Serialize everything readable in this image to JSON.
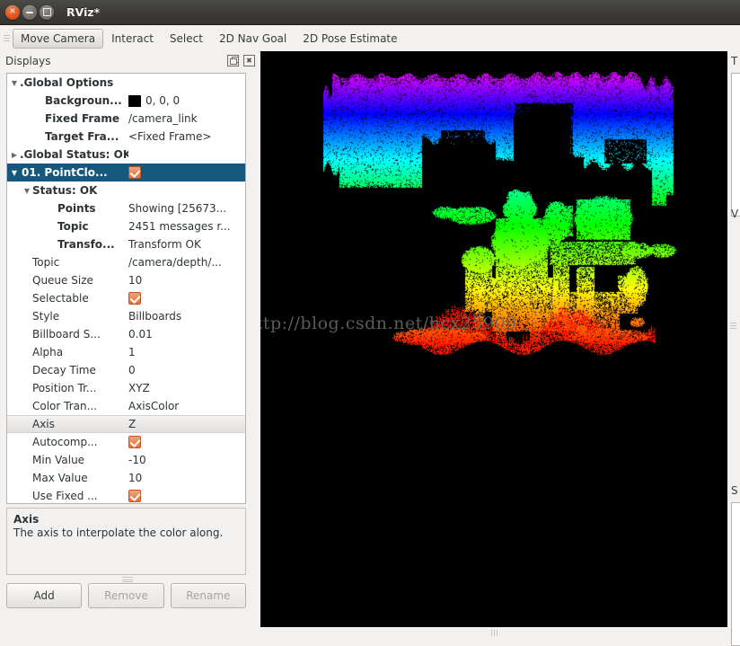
{
  "window": {
    "title": "RViz*",
    "buttons": {
      "close": "close-button",
      "minimize": "minimize-button",
      "maximize": "maximize-button"
    }
  },
  "toolbar": {
    "items": [
      {
        "label": "Move Camera",
        "active": true
      },
      {
        "label": "Interact",
        "active": false
      },
      {
        "label": "Select",
        "active": false
      },
      {
        "label": "2D Nav Goal",
        "active": false
      },
      {
        "label": "2D Pose Estimate",
        "active": false
      }
    ]
  },
  "displays_panel": {
    "title": "Displays",
    "float_icon": "float-icon",
    "close_icon": "close-icon",
    "tree": [
      {
        "indent": 1,
        "arrow": "down",
        "key": ".Global Options",
        "bold": true,
        "value": ""
      },
      {
        "indent": 3,
        "arrow": "",
        "key": "Backgroun...",
        "bold": true,
        "value": "0, 0, 0",
        "swatch": "#000000"
      },
      {
        "indent": 3,
        "arrow": "",
        "key": "Fixed Frame",
        "bold": true,
        "value": "/camera_link"
      },
      {
        "indent": 3,
        "arrow": "",
        "key": "Target Fra...",
        "bold": true,
        "value": "<Fixed Frame>"
      },
      {
        "indent": 1,
        "arrow": "right",
        "key": ".Global Status: OK",
        "bold": true,
        "value": ""
      },
      {
        "indent": 1,
        "arrow": "down",
        "key": "01. PointClo...",
        "bold": true,
        "value": "",
        "checkbox": true,
        "selected": true
      },
      {
        "indent": 2,
        "arrow": "down",
        "key": "Status: OK",
        "bold": true,
        "value": ""
      },
      {
        "indent": 4,
        "arrow": "",
        "key": "Points",
        "bold": true,
        "value": "Showing [25673..."
      },
      {
        "indent": 4,
        "arrow": "",
        "key": "Topic",
        "bold": true,
        "value": "2451 messages r..."
      },
      {
        "indent": 4,
        "arrow": "",
        "key": "Transfo...",
        "bold": true,
        "value": "Transform OK"
      },
      {
        "indent": 2,
        "arrow": "",
        "key": "Topic",
        "bold": false,
        "value": "/camera/depth/..."
      },
      {
        "indent": 2,
        "arrow": "",
        "key": "Queue Size",
        "bold": false,
        "value": "10"
      },
      {
        "indent": 2,
        "arrow": "",
        "key": "Selectable",
        "bold": false,
        "value": "",
        "checkbox": true
      },
      {
        "indent": 2,
        "arrow": "",
        "key": "Style",
        "bold": false,
        "value": "Billboards"
      },
      {
        "indent": 2,
        "arrow": "",
        "key": "Billboard S...",
        "bold": false,
        "value": "0.01"
      },
      {
        "indent": 2,
        "arrow": "",
        "key": "Alpha",
        "bold": false,
        "value": "1"
      },
      {
        "indent": 2,
        "arrow": "",
        "key": "Decay Time",
        "bold": false,
        "value": "0"
      },
      {
        "indent": 2,
        "arrow": "",
        "key": "Position Tr...",
        "bold": false,
        "value": "XYZ"
      },
      {
        "indent": 2,
        "arrow": "",
        "key": "Color Tran...",
        "bold": false,
        "value": "AxisColor"
      },
      {
        "indent": 2,
        "arrow": "",
        "key": "Axis",
        "bold": false,
        "value": "Z",
        "highlighted": true
      },
      {
        "indent": 2,
        "arrow": "",
        "key": "Autocomp...",
        "bold": false,
        "value": "",
        "checkbox": true
      },
      {
        "indent": 2,
        "arrow": "",
        "key": "Min Value",
        "bold": false,
        "value": "-10"
      },
      {
        "indent": 2,
        "arrow": "",
        "key": "Max Value",
        "bold": false,
        "value": "10"
      },
      {
        "indent": 2,
        "arrow": "",
        "key": "Use Fixed ...",
        "bold": false,
        "value": "",
        "checkbox": true
      }
    ],
    "description": {
      "title": "Axis",
      "body": "The axis to interpolate the color along."
    },
    "buttons": [
      {
        "label": "Add",
        "enabled": true
      },
      {
        "label": "Remove",
        "enabled": false
      },
      {
        "label": "Rename",
        "enabled": false
      }
    ]
  },
  "viewport": {
    "background": "#000000",
    "watermark": "http://blog.csdn.net/hcx25909"
  },
  "right_panels": [
    {
      "label": "T"
    },
    {
      "label": "V"
    },
    {
      "label": "S"
    }
  ],
  "colors": {
    "selection": "#16577d",
    "checkbox": "#e8703a",
    "window_chrome": "#3c3b37",
    "panel_bg": "#f2f1f0"
  }
}
